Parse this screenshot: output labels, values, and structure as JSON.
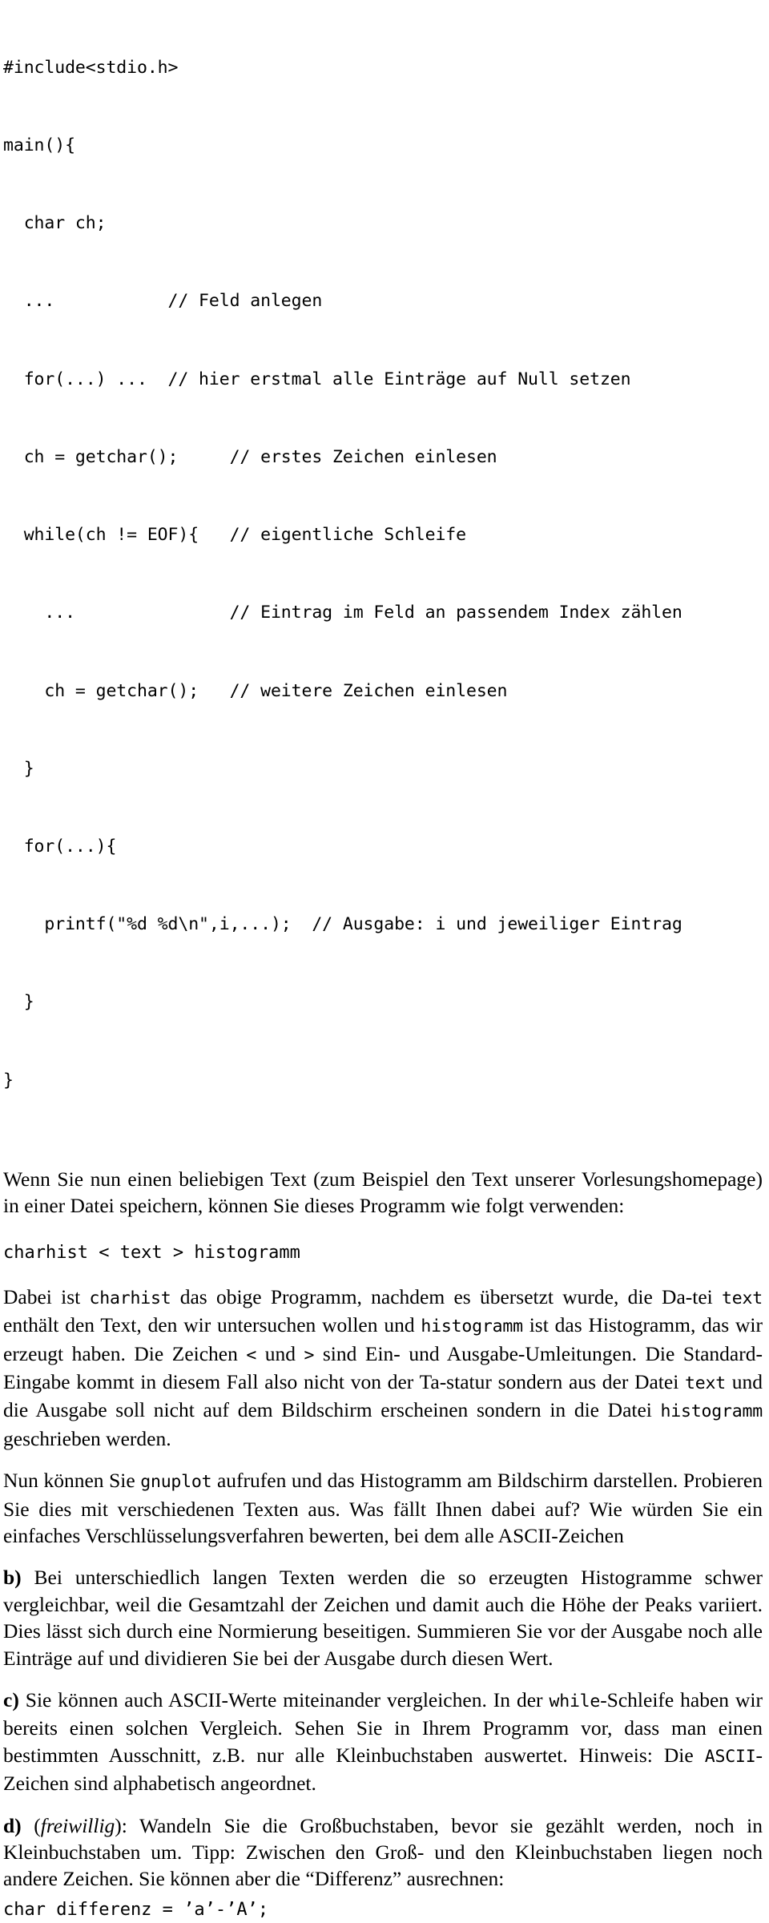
{
  "document": {
    "language": "de",
    "type": "programming-exercise-sheet"
  },
  "code_block": {
    "name": "charhist-c-source-listing",
    "lines": [
      "#include<stdio.h>",
      "main(){",
      "  char ch;",
      "  ...           // Feld anlegen",
      "  for(...) ...  // hier erstmal alle Einträge auf Null setzen",
      "  ch = getchar();     // erstes Zeichen einlesen",
      "  while(ch != EOF){   // eigentliche Schleife",
      "    ...               // Eintrag im Feld an passendem Index zählen",
      "    ch = getchar();   // weitere Zeichen einlesen",
      "  }",
      "  for(...){",
      "    printf(\"%d %d\\n\",i,...);  // Ausgabe: i und jeweiliger Eintrag",
      "  }",
      "}"
    ]
  },
  "paragraphs": {
    "intro": {
      "segments": [
        {
          "type": "text",
          "value": "Wenn Sie nun einen beliebigen Text (zum Beispiel den Text unserer Vorlesungsho-mepage) in einer Datei speichern, können Sie dieses Programm wie folgt verwenden:"
        }
      ],
      "plain": "Wenn Sie nun einen beliebigen Text (zum Beispiel den Text unserer Vorlesungshomepage) in einer Datei speichern, können Sie dieses Programm wie folgt verwenden:"
    },
    "command_line": "charhist < text > histogramm",
    "explanation": {
      "t1": "Dabei ist ",
      "c1": "charhist",
      "t2": " das obige Programm, nachdem es übersetzt wurde, die Da-tei ",
      "c2": "text",
      "t3": " enthält den Text, den wir untersuchen wollen und ",
      "c3": "histogramm",
      "t4": " ist das Histogramm, das wir erzeugt haben. Die Zeichen ",
      "c4": "<",
      "t5": " und ",
      "c5": ">",
      "t6": " sind Ein- und Ausgabe-Umleitungen. Die Standard-Eingabe kommt in diesem Fall also nicht von der Ta-statur sondern aus der Datei ",
      "c6": "text",
      "t7": " und die Ausgabe soll nicht auf dem Bildschirm erscheinen sondern in die Datei ",
      "c7": "histogramm",
      "t8": " geschrieben werden."
    },
    "gnuplot": {
      "t1": "Nun können Sie ",
      "c1": "gnuplot",
      "t2": " aufrufen und das Histogramm am Bildschirm darstellen. Probieren Sie dies mit verschiedenen Texten aus. Was fällt Ihnen dabei auf? Wie würden Sie ein einfaches Verschlüsselungsverfahren bewerten, bei dem alle ASCII-Zeichen"
    },
    "item_b": {
      "label": "b)",
      "text": " Bei unterschiedlich langen Texten werden die so erzeugten Histogramme schwer vergleichbar, weil die Gesamtzahl der Zeichen und damit auch die Höhe der Peaks variiert. Dies lässt sich durch eine Normierung beseitigen. Summieren Sie vor der Ausgabe noch alle Einträge auf und dividieren Sie bei der Ausgabe durch diesen Wert."
    },
    "item_c": {
      "label": "c)",
      "t1": " Sie können auch ASCII-Werte miteinander vergleichen. In der ",
      "c1": "while",
      "t2": "-Schleife haben wir bereits einen solchen Vergleich. Sehen Sie in Ihrem Programm vor, dass man einen bestimmten Ausschnitt, z.B. nur alle Kleinbuchstaben auswertet. Hinweis: Die ",
      "c2": "ASCII",
      "t3": "-Zeichen sind alphabetisch angeordnet."
    },
    "item_d": {
      "label": "d)",
      "t1": " (",
      "italic": "freiwillig",
      "t2": "): Wandeln Sie die Großbuchstaben, bevor sie gezählt werden, noch in Kleinbuchstaben um. Tipp: Zwischen den Groß- und den Kleinbuchstaben liegen noch andere Zeichen. Sie können aber die “Differenz” ausrechnen:"
    },
    "final_code_line": "char differenz = ’a’-’A’;"
  }
}
